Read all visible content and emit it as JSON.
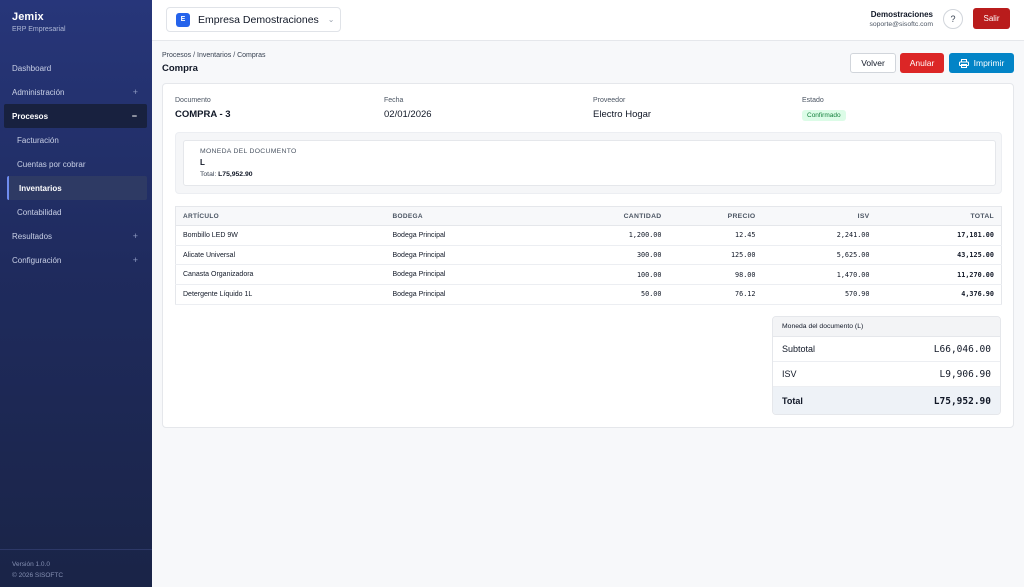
{
  "brand": {
    "name": "Jemix",
    "subtitle": "ERP Empresarial"
  },
  "sidebar": {
    "items": [
      {
        "label": "Dashboard",
        "sign": ""
      },
      {
        "label": "Administración",
        "sign": "+"
      },
      {
        "label": "Procesos",
        "sign": "−"
      },
      {
        "label": "Facturación"
      },
      {
        "label": "Cuentas por cobrar"
      },
      {
        "label": "Inventarios"
      },
      {
        "label": "Contabilidad"
      },
      {
        "label": "Resultados",
        "sign": "+"
      },
      {
        "label": "Configuración",
        "sign": "+"
      }
    ],
    "version": "Versión 1.0.0",
    "copyright": "© 2026 SISOFTC"
  },
  "topbar": {
    "company_badge": "E",
    "company_name": "Empresa Demostraciones",
    "user_name": "Demostraciones",
    "user_email": "soporte@sisoftc.com",
    "help_icon": "?",
    "logout_label": "Salir"
  },
  "header": {
    "breadcrumb": "Procesos / Inventarios / Compras",
    "title": "Compra",
    "back_label": "Volver",
    "cancel_label": "Anular",
    "print_label": "Imprimir"
  },
  "document": {
    "number_label": "Documento",
    "number": "COMPRA - 3",
    "date_label": "Fecha",
    "date": "02/01/2026",
    "supplier_label": "Proveedor",
    "supplier": "Electro Hogar",
    "status_label": "Estado",
    "status": "Confirmado",
    "status_color": "#15803d"
  },
  "currency": {
    "label": "MONEDA DEL DOCUMENTO",
    "value": "L",
    "total_label": "Total:",
    "total_value": "L75,952.90"
  },
  "table": {
    "columns": [
      "ARTÍCULO",
      "BODEGA",
      "CANTIDAD",
      "PRECIO",
      "ISV",
      "TOTAL"
    ],
    "rows": [
      [
        "Bombillo LED 9W",
        "Bodega Principal",
        "1,200.00",
        "12.45",
        "2,241.00",
        "17,181.00"
      ],
      [
        "Alicate Universal",
        "Bodega Principal",
        "300.00",
        "125.00",
        "5,625.00",
        "43,125.00"
      ],
      [
        "Canasta Organizadora",
        "Bodega Principal",
        "100.00",
        "98.00",
        "1,470.00",
        "11,270.00"
      ],
      [
        "Detergente Líquido 1L",
        "Bodega Principal",
        "50.00",
        "76.12",
        "570.90",
        "4,376.90"
      ]
    ]
  },
  "summary": {
    "header": "Moneda del documento (L)",
    "subtotal_label": "Subtotal",
    "subtotal": "L66,046.00",
    "isv_label": "ISV",
    "isv": "L9,906.90",
    "total_label": "Total",
    "total": "L75,952.90"
  },
  "colors": {
    "sidebar": "#1f2b5e",
    "danger": "#dc2626",
    "primary": "#0284c7",
    "logout": "#b91c1c"
  }
}
